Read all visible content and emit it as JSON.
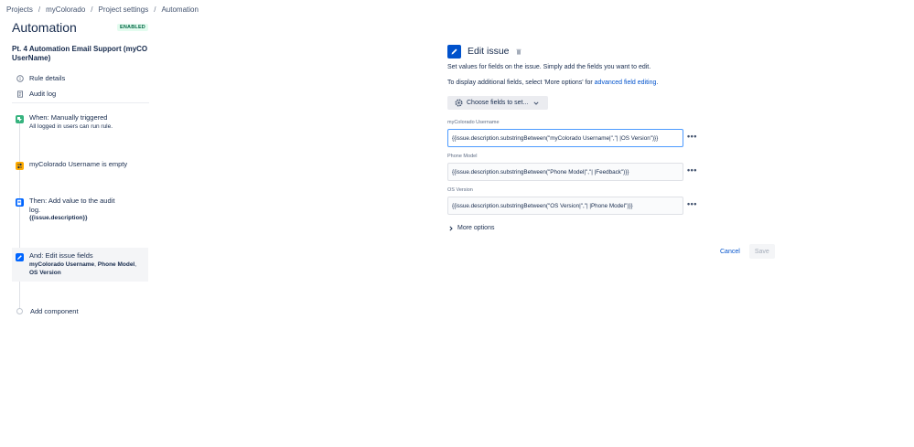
{
  "breadcrumb": {
    "items": [
      "Projects",
      "myColorado",
      "Project settings",
      "Automation"
    ],
    "separator": "/"
  },
  "header": {
    "title": "Automation",
    "status": "ENABLED"
  },
  "rule": {
    "title": "Pt. 4 Automation Email Support (myCO UserName)"
  },
  "side_nav": {
    "items": [
      {
        "label": "Rule details",
        "icon": "info-icon"
      },
      {
        "label": "Audit log",
        "icon": "audit-log-icon"
      }
    ]
  },
  "components": [
    {
      "heading": "When: Manually triggered",
      "sub": "All logged in users can run rule.",
      "icon": "trigger-icon",
      "color": "#36b37e"
    },
    {
      "heading": "myColorado Username is empty",
      "icon": "condition-icon",
      "color": "#ffab00"
    },
    {
      "heading": "Then: Add value to the audit log.",
      "sub": "{{issue.description}}",
      "icon": "action-icon",
      "color": "#0065ff"
    },
    {
      "heading": "And: Edit issue fields",
      "fields": [
        "myColorado Username",
        "Phone Model",
        "OS Version"
      ],
      "icon": "edit-icon",
      "color": "#0065ff"
    }
  ],
  "add_component": {
    "label": "Add component"
  },
  "panel": {
    "title": "Edit issue",
    "desc1": "Set values for fields on the issue. Simply add the fields you want to edit.",
    "desc2_prefix": "To display additional fields, select 'More options' for ",
    "desc2_link": "advanced field editing",
    "desc2_suffix": ".",
    "choose_button": "Choose fields to set...",
    "fields": [
      {
        "label": "myColorado Username",
        "value": "{{issue.description.substringBetween(\"myColorado Username|\",\"| |OS Version\")}}"
      },
      {
        "label": "Phone Model",
        "value": "{{issue.description.substringBetween(\"Phone Model|\",\"| |Feedback\")}}"
      },
      {
        "label": "OS Version",
        "value": "{{issue.description.substringBetween(\"OS Version|\",\"| |Phone Model\")}}"
      }
    ],
    "more_options": "More options",
    "cancel": "Cancel",
    "save": "Save"
  },
  "colors": {
    "accent": "#0052cc",
    "enabled_bg": "#e3fcef",
    "enabled_text": "#006644"
  }
}
